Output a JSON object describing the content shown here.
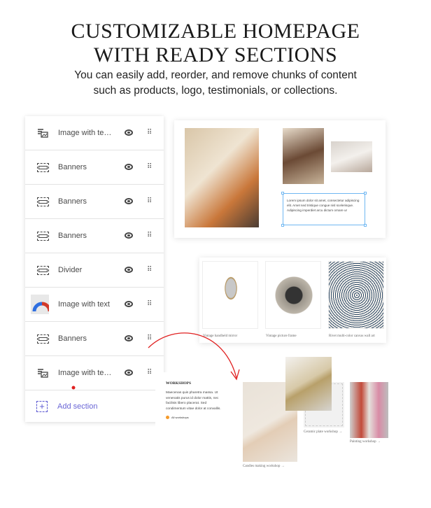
{
  "header": {
    "title_line1": "CUSTOMIZABLE HOMEPAGE",
    "title_line2": "WITH READY SECTIONS",
    "subtitle_line1": "You can easily add, reorder, and remove chunks of content",
    "subtitle_line2": "such as products, logo, testimonials, or collections."
  },
  "sections": [
    {
      "label": "Image with text ...",
      "icon": "image-with-text-icon"
    },
    {
      "label": "Banners",
      "icon": "banner-icon"
    },
    {
      "label": "Banners",
      "icon": "banner-icon"
    },
    {
      "label": "Banners",
      "icon": "banner-icon"
    },
    {
      "label": "Divider",
      "icon": "banner-icon"
    },
    {
      "label": "Image with text",
      "icon": "gauge-thumbnail-icon"
    },
    {
      "label": "Banners",
      "icon": "banner-icon"
    },
    {
      "label": "Image with text ...",
      "icon": "image-with-text-icon"
    }
  ],
  "add_section": "Add section",
  "preview1": {
    "lorem": "Lorem ipsum dolor sit amet, consectetur adipiscing elit. Amet sed tristique congue nisl scelerisque. Adipiscing imperdiet arcu dictum ornare ur"
  },
  "preview2": {
    "captions": [
      "Vintage handheld mirror",
      "Vintage picture frame",
      "Rivet multi-color canvas wall art"
    ]
  },
  "preview3": {
    "heading": "WORKSHOPS",
    "body": "Maecenas quis pharetra massa. Ut venenatis purus id dolor mattis, nec facilisis libero placerat. Sed condimentum vitae dolor at convallis.",
    "link": "All workshops",
    "captions": [
      "Candles making workshop →",
      "Ceramic plate workshop →",
      "Painting workshop →"
    ]
  },
  "colors": {
    "accent": "#5b57d1",
    "arrow": "#e02020",
    "selection": "#6fb7f2"
  }
}
